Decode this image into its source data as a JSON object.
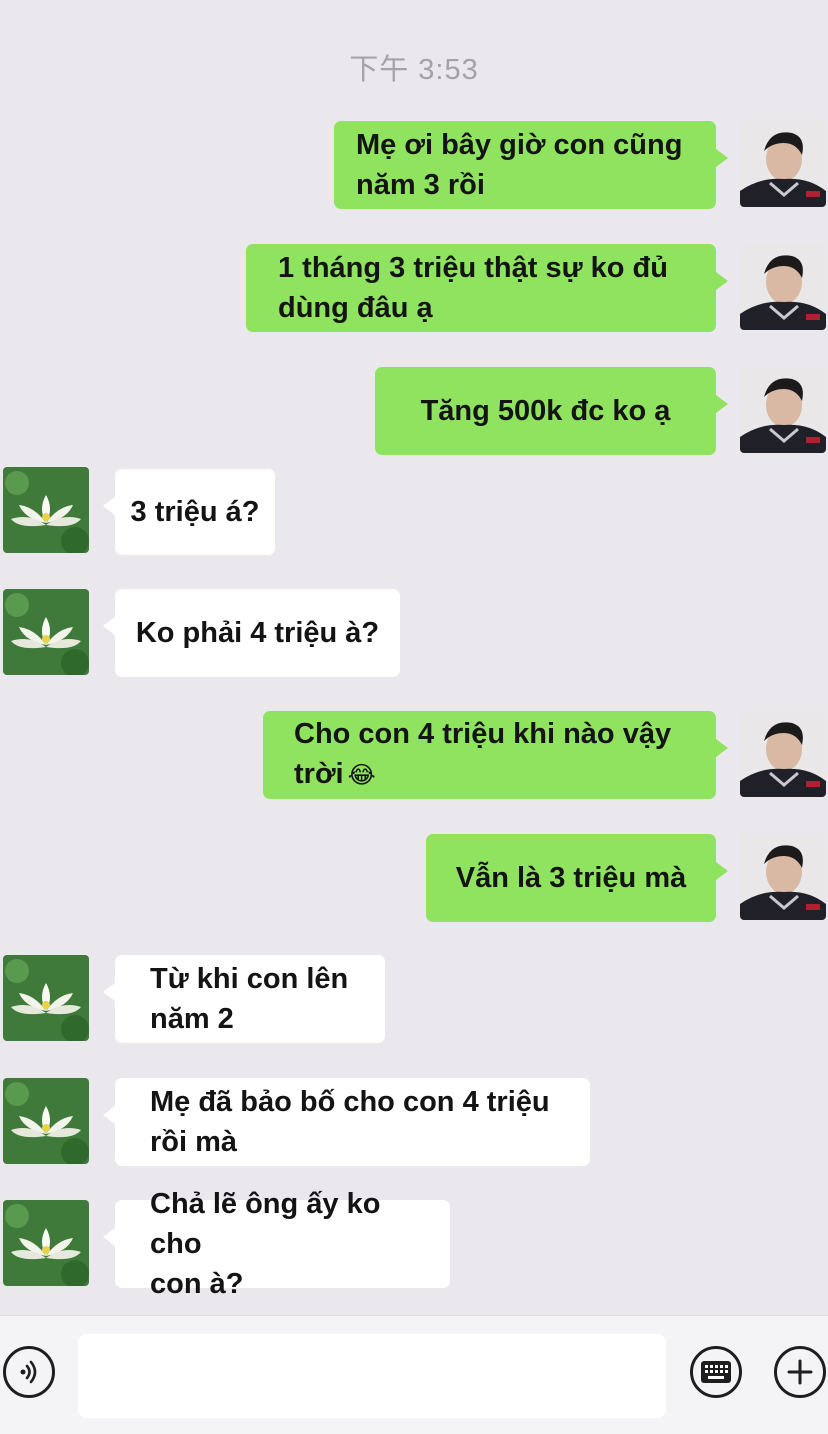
{
  "header": {
    "timestamp": "下午 3:53"
  },
  "messages": [
    {
      "side": "out",
      "lines": [
        "Mẹ ơi bây giờ con cũng",
        "năm 3 rồi"
      ]
    },
    {
      "side": "out",
      "lines": [
        "1 tháng 3 triệu thật sự ko đủ",
        "dùng đâu ạ"
      ]
    },
    {
      "side": "out",
      "lines": [
        "Tăng 500k đc ko ạ"
      ]
    },
    {
      "side": "in",
      "lines": [
        "3 triệu á?"
      ]
    },
    {
      "side": "in",
      "lines": [
        "Ko phải 4 triệu à?"
      ]
    },
    {
      "side": "out",
      "lines": [
        "Cho con 4 triệu khi nào vậy",
        "trời"
      ],
      "emoji": "😂"
    },
    {
      "side": "out",
      "lines": [
        "Vẫn là 3 triệu mà"
      ]
    },
    {
      "side": "in",
      "lines": [
        "Từ khi con lên",
        "năm 2"
      ]
    },
    {
      "side": "in",
      "lines": [
        "Mẹ đã bảo bố cho con 4 triệu",
        "rồi mà"
      ]
    },
    {
      "side": "in",
      "lines": [
        "Chả lẽ ông ấy ko cho",
        "con à?"
      ]
    }
  ],
  "avatars": {
    "self": "man-avatar",
    "contact": "lotus-avatar"
  },
  "input_bar": {
    "voice_icon": "voice-icon",
    "keyboard_icon": "keyboard-icon",
    "plus_icon": "plus-icon",
    "message_placeholder": ""
  },
  "colors": {
    "outgoing_bubble": "#8fe35f",
    "incoming_bubble": "#ffffff",
    "background": "#ebe8ed"
  }
}
